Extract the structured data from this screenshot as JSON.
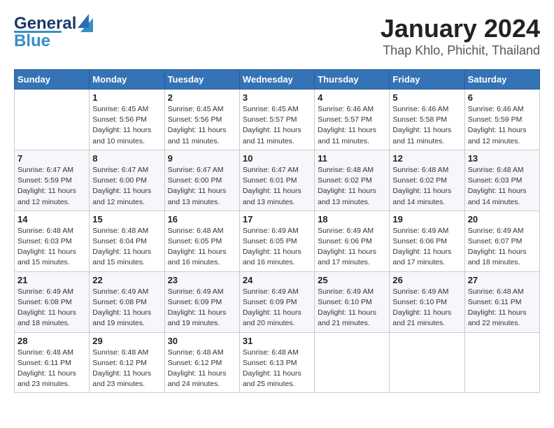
{
  "logo": {
    "line1": "General",
    "line2": "Blue"
  },
  "title": "January 2024",
  "subtitle": "Thap Khlo, Phichit, Thailand",
  "days_of_week": [
    "Sunday",
    "Monday",
    "Tuesday",
    "Wednesday",
    "Thursday",
    "Friday",
    "Saturday"
  ],
  "weeks": [
    [
      {
        "day": "",
        "info": ""
      },
      {
        "day": "1",
        "info": "Sunrise: 6:45 AM\nSunset: 5:56 PM\nDaylight: 11 hours\nand 10 minutes."
      },
      {
        "day": "2",
        "info": "Sunrise: 6:45 AM\nSunset: 5:56 PM\nDaylight: 11 hours\nand 11 minutes."
      },
      {
        "day": "3",
        "info": "Sunrise: 6:45 AM\nSunset: 5:57 PM\nDaylight: 11 hours\nand 11 minutes."
      },
      {
        "day": "4",
        "info": "Sunrise: 6:46 AM\nSunset: 5:57 PM\nDaylight: 11 hours\nand 11 minutes."
      },
      {
        "day": "5",
        "info": "Sunrise: 6:46 AM\nSunset: 5:58 PM\nDaylight: 11 hours\nand 11 minutes."
      },
      {
        "day": "6",
        "info": "Sunrise: 6:46 AM\nSunset: 5:59 PM\nDaylight: 11 hours\nand 12 minutes."
      }
    ],
    [
      {
        "day": "7",
        "info": "Sunrise: 6:47 AM\nSunset: 5:59 PM\nDaylight: 11 hours\nand 12 minutes."
      },
      {
        "day": "8",
        "info": "Sunrise: 6:47 AM\nSunset: 6:00 PM\nDaylight: 11 hours\nand 12 minutes."
      },
      {
        "day": "9",
        "info": "Sunrise: 6:47 AM\nSunset: 6:00 PM\nDaylight: 11 hours\nand 13 minutes."
      },
      {
        "day": "10",
        "info": "Sunrise: 6:47 AM\nSunset: 6:01 PM\nDaylight: 11 hours\nand 13 minutes."
      },
      {
        "day": "11",
        "info": "Sunrise: 6:48 AM\nSunset: 6:02 PM\nDaylight: 11 hours\nand 13 minutes."
      },
      {
        "day": "12",
        "info": "Sunrise: 6:48 AM\nSunset: 6:02 PM\nDaylight: 11 hours\nand 14 minutes."
      },
      {
        "day": "13",
        "info": "Sunrise: 6:48 AM\nSunset: 6:03 PM\nDaylight: 11 hours\nand 14 minutes."
      }
    ],
    [
      {
        "day": "14",
        "info": "Sunrise: 6:48 AM\nSunset: 6:03 PM\nDaylight: 11 hours\nand 15 minutes."
      },
      {
        "day": "15",
        "info": "Sunrise: 6:48 AM\nSunset: 6:04 PM\nDaylight: 11 hours\nand 15 minutes."
      },
      {
        "day": "16",
        "info": "Sunrise: 6:48 AM\nSunset: 6:05 PM\nDaylight: 11 hours\nand 16 minutes."
      },
      {
        "day": "17",
        "info": "Sunrise: 6:49 AM\nSunset: 6:05 PM\nDaylight: 11 hours\nand 16 minutes."
      },
      {
        "day": "18",
        "info": "Sunrise: 6:49 AM\nSunset: 6:06 PM\nDaylight: 11 hours\nand 17 minutes."
      },
      {
        "day": "19",
        "info": "Sunrise: 6:49 AM\nSunset: 6:06 PM\nDaylight: 11 hours\nand 17 minutes."
      },
      {
        "day": "20",
        "info": "Sunrise: 6:49 AM\nSunset: 6:07 PM\nDaylight: 11 hours\nand 18 minutes."
      }
    ],
    [
      {
        "day": "21",
        "info": "Sunrise: 6:49 AM\nSunset: 6:08 PM\nDaylight: 11 hours\nand 18 minutes."
      },
      {
        "day": "22",
        "info": "Sunrise: 6:49 AM\nSunset: 6:08 PM\nDaylight: 11 hours\nand 19 minutes."
      },
      {
        "day": "23",
        "info": "Sunrise: 6:49 AM\nSunset: 6:09 PM\nDaylight: 11 hours\nand 19 minutes."
      },
      {
        "day": "24",
        "info": "Sunrise: 6:49 AM\nSunset: 6:09 PM\nDaylight: 11 hours\nand 20 minutes."
      },
      {
        "day": "25",
        "info": "Sunrise: 6:49 AM\nSunset: 6:10 PM\nDaylight: 11 hours\nand 21 minutes."
      },
      {
        "day": "26",
        "info": "Sunrise: 6:49 AM\nSunset: 6:10 PM\nDaylight: 11 hours\nand 21 minutes."
      },
      {
        "day": "27",
        "info": "Sunrise: 6:48 AM\nSunset: 6:11 PM\nDaylight: 11 hours\nand 22 minutes."
      }
    ],
    [
      {
        "day": "28",
        "info": "Sunrise: 6:48 AM\nSunset: 6:11 PM\nDaylight: 11 hours\nand 23 minutes."
      },
      {
        "day": "29",
        "info": "Sunrise: 6:48 AM\nSunset: 6:12 PM\nDaylight: 11 hours\nand 23 minutes."
      },
      {
        "day": "30",
        "info": "Sunrise: 6:48 AM\nSunset: 6:12 PM\nDaylight: 11 hours\nand 24 minutes."
      },
      {
        "day": "31",
        "info": "Sunrise: 6:48 AM\nSunset: 6:13 PM\nDaylight: 11 hours\nand 25 minutes."
      },
      {
        "day": "",
        "info": ""
      },
      {
        "day": "",
        "info": ""
      },
      {
        "day": "",
        "info": ""
      }
    ]
  ]
}
